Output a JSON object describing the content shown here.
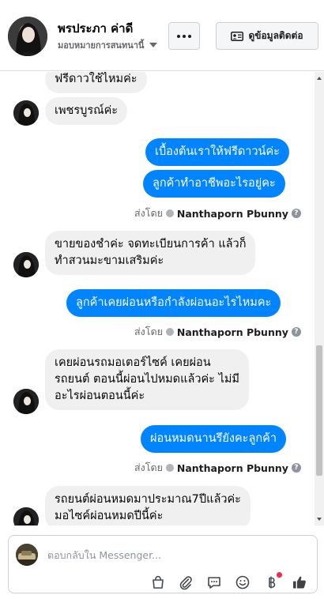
{
  "header": {
    "name": "พรประภา ค่าดี",
    "subtitle": "มอบหมายการสนทนานี้",
    "contact_label": "ดูข้อมูลติดต่อ"
  },
  "messages": [
    {
      "id": "m1",
      "dir": "in",
      "lines": [
        "ฟรีดาวใช้ไหมค่ะ"
      ]
    },
    {
      "id": "m2",
      "dir": "in",
      "lines": [
        "เพชรบูรณ์ค่ะ"
      ]
    },
    {
      "id": "m3",
      "dir": "out",
      "lines": [
        "เบื้องต้นเราให้ฟรีดาวน์ค่ะ"
      ]
    },
    {
      "id": "m4",
      "dir": "out",
      "lines": [
        "ลูกค้าทำอาชีพอะไรอยู่คะ"
      ]
    },
    {
      "id": "m5",
      "dir": "in",
      "lines": [
        "ขายของชำค่ะ จดทะเบียนการค้า แล้วก็",
        "ทำสวนมะขามเสริมค่ะ"
      ]
    },
    {
      "id": "m6",
      "dir": "out",
      "lines": [
        "ลูกค้าเคยผ่อนหรือกำลังผ่อนอะไรไหมคะ"
      ]
    },
    {
      "id": "m7",
      "dir": "in",
      "lines": [
        "เคยผ่อนรถมอเตอร์ไซค์ เคยผ่อน",
        "รถยนต์ ตอนนี้ผ่อนไปหมดแล้วค่ะ ไม่มี",
        "อะไรผ่อนตอนนี้ค่ะ"
      ]
    },
    {
      "id": "m8",
      "dir": "out",
      "lines": [
        "ผ่อนหมดนานรึยังคะลูกค้า"
      ]
    },
    {
      "id": "m9",
      "dir": "in",
      "lines": [
        "รถยนต์ผ่อนหมดมาประมาณ7ปีแล้วค่ะ",
        "มอไซค์ผ่อนหมดปีนี้ค่ะ"
      ]
    }
  ],
  "sent_by": {
    "prefix": "ส่งโดย",
    "name": "Nanthaporn Pbunny",
    "help": "?"
  },
  "composer": {
    "placeholder": "ตอบกลับใน Messenger..."
  },
  "toolbar_icons": [
    "shopping-bag-icon",
    "paperclip-icon",
    "chat-bubble-icon",
    "emoji-icon",
    "baht-icon",
    "thumbs-up-icon"
  ],
  "colors": {
    "outgoing_bubble": "#0084ff",
    "incoming_bubble": "#f0f0f0",
    "notification_dot": "#f02849"
  }
}
